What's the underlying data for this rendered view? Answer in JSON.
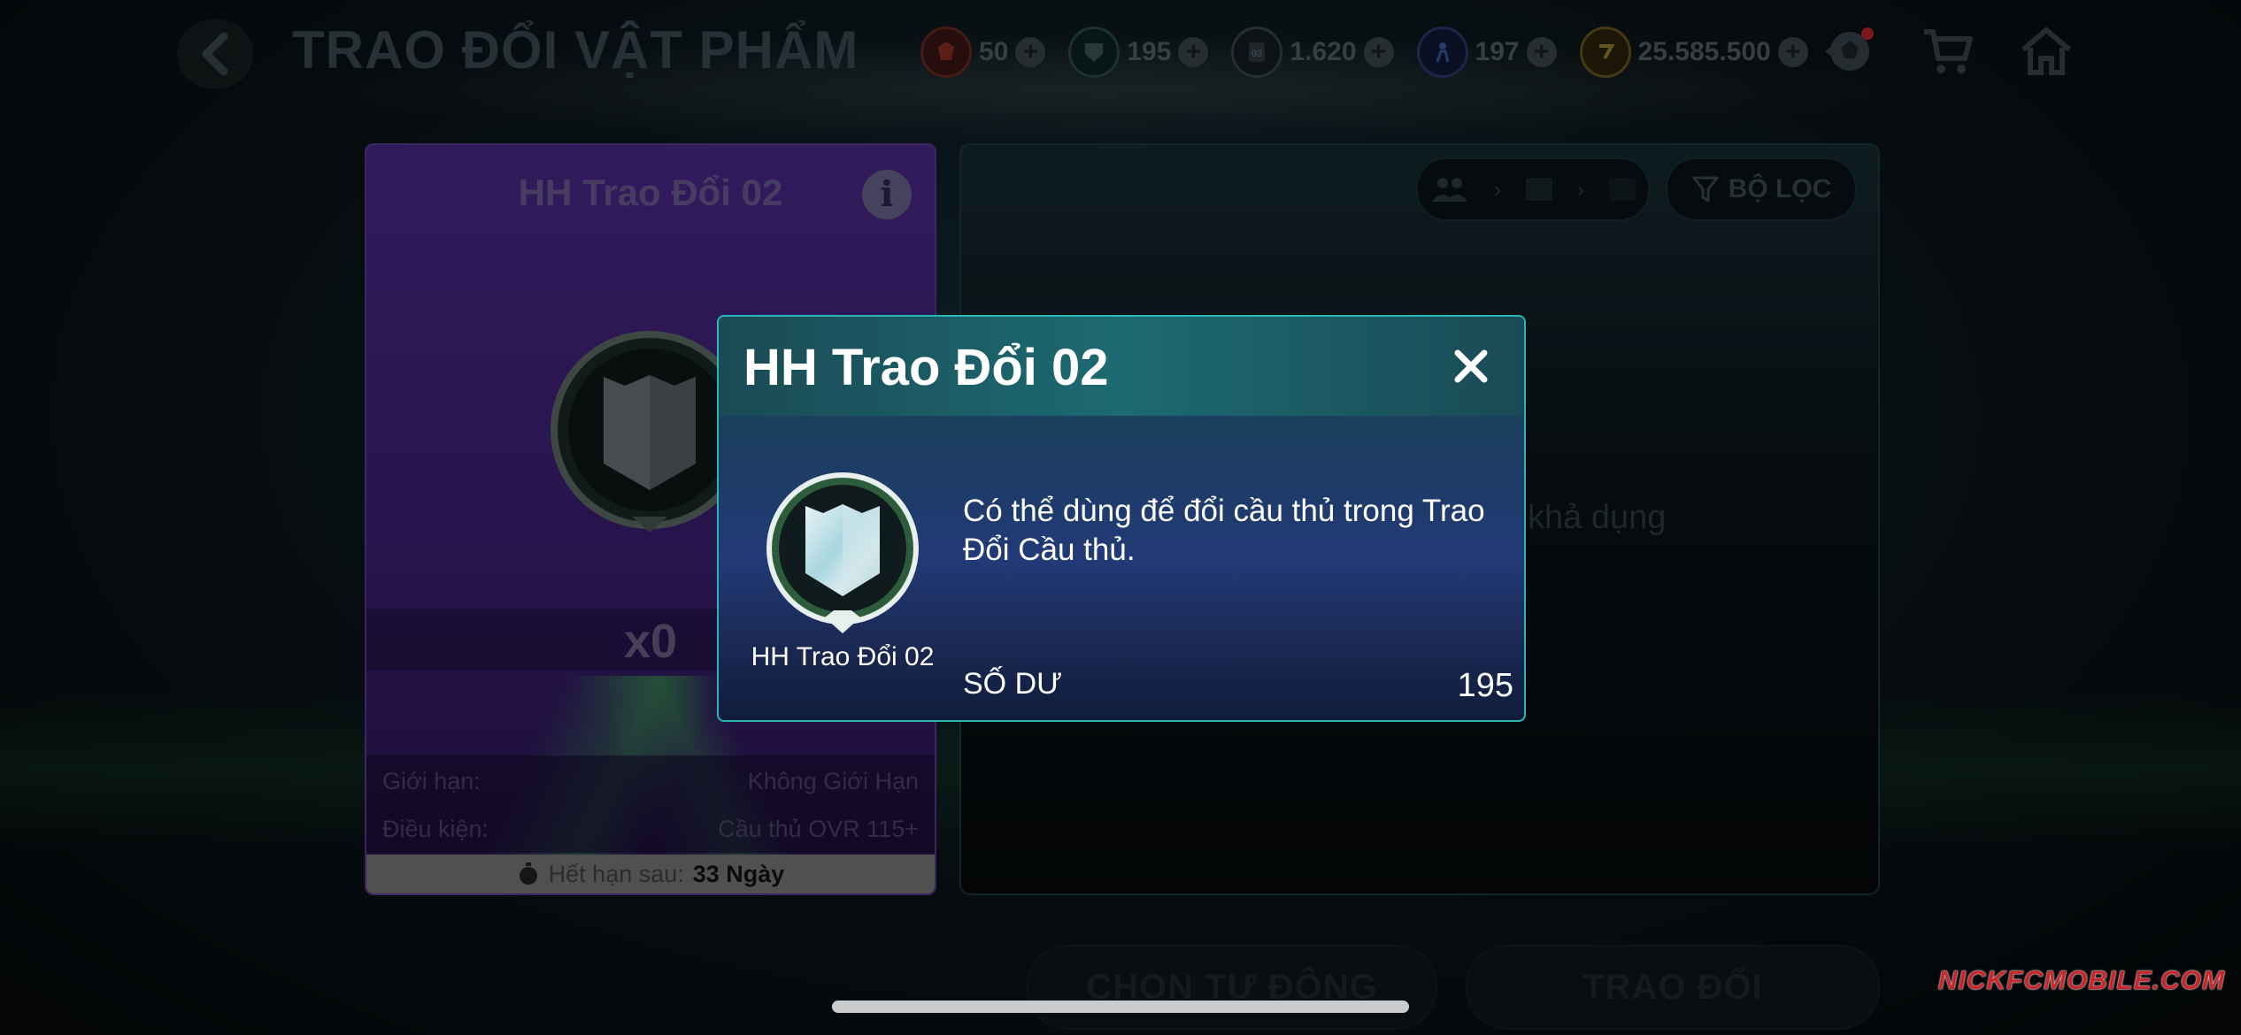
{
  "header": {
    "title": "TRAO ĐỔI VẬT PHẨM",
    "currencies": [
      {
        "icon": "red-token-icon",
        "value": "50",
        "color": "#c0392b"
      },
      {
        "icon": "shield-token-icon",
        "value": "195",
        "color": "#2e7d6f"
      },
      {
        "icon": "card-token-icon",
        "value": "1.620",
        "color": "#3a5a78"
      },
      {
        "icon": "player-token-icon",
        "value": "197",
        "color": "#2a4f9e"
      },
      {
        "icon": "fc-coin-icon",
        "value": "25.585.500",
        "color": "#c9a227"
      }
    ]
  },
  "left_card": {
    "title": "HH Trao Đổi 02",
    "count": "x0",
    "limit_label": "Giới hạn:",
    "limit_value": "Không Giới Hạn",
    "condition_label": "Điều kiện:",
    "condition_value": "Cầu thủ OVR 115+",
    "expiry_label": "Hết hạn sau:",
    "expiry_value": "33 Ngày"
  },
  "right_panel": {
    "filter_label": "BỘ LỌC",
    "empty_text": "khả dụng"
  },
  "bottom": {
    "auto_select_label": "CHỌN TỰ ĐỘNG",
    "exchange_label": "TRAO ĐỔI"
  },
  "watermark": "NICKFCMOBILE.COM",
  "modal": {
    "title": "HH Trao Đổi 02",
    "badge_label": "HH Trao Đổi 02",
    "description": "Có thể dùng để đổi cầu thủ trong Trao Đổi Cầu thủ.",
    "balance_label": "SỐ DƯ",
    "balance_value": "195"
  }
}
